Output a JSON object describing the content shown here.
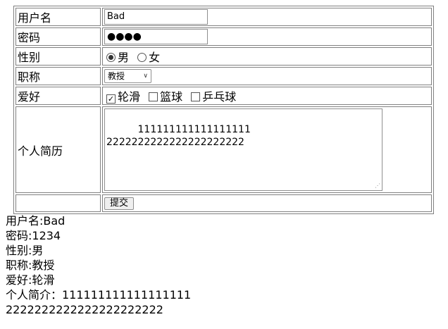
{
  "form": {
    "username_label": "用户名",
    "username_value": "Bad",
    "password_label": "密码",
    "password_mask": "●●●●",
    "gender_label": "性别",
    "gender_options": [
      {
        "label": "男",
        "checked": true
      },
      {
        "label": "女",
        "checked": false
      }
    ],
    "title_label": "职称",
    "title_selected": "教授",
    "hobby_label": "爱好",
    "hobbies": [
      {
        "label": "轮滑",
        "checked": true
      },
      {
        "label": "篮球",
        "checked": false
      },
      {
        "label": "乒乓球",
        "checked": false
      }
    ],
    "resume_label": "个人简历",
    "resume_text": "111111111111111111\n2222222222222222222222",
    "submit_label": "提交"
  },
  "output": {
    "lines": [
      "用户名:Bad",
      "密码:1234",
      "性别:男",
      "职称:教授",
      "爱好:轮滑",
      "个人简介：111111111111111111",
      "2222222222222222222222"
    ]
  }
}
